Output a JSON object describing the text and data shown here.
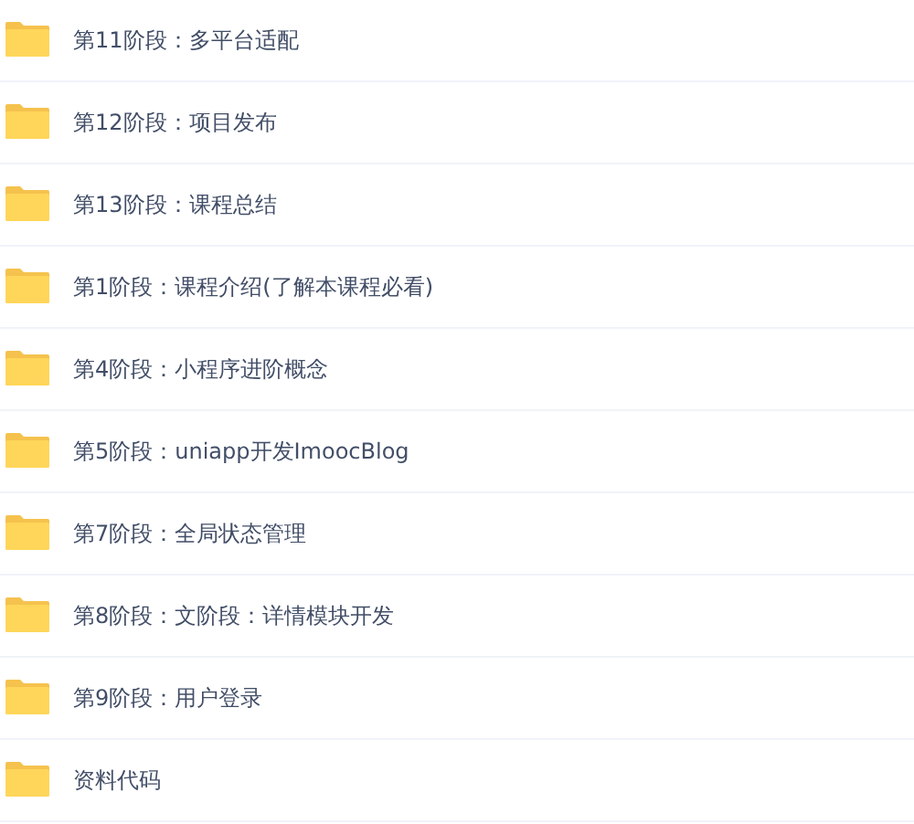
{
  "folders": [
    {
      "name": "第11阶段：多平台适配"
    },
    {
      "name": "第12阶段：项目发布"
    },
    {
      "name": "第13阶段：课程总结"
    },
    {
      "name": "第1阶段：课程介绍(了解本课程必看)"
    },
    {
      "name": "第4阶段：小程序进阶概念"
    },
    {
      "name": "第5阶段：uniapp开发ImoocBlog"
    },
    {
      "name": "第7阶段：全局状态管理"
    },
    {
      "name": "第8阶段：文阶段：详情模块开发"
    },
    {
      "name": "第9阶段：用户登录"
    },
    {
      "name": "资料代码"
    }
  ]
}
